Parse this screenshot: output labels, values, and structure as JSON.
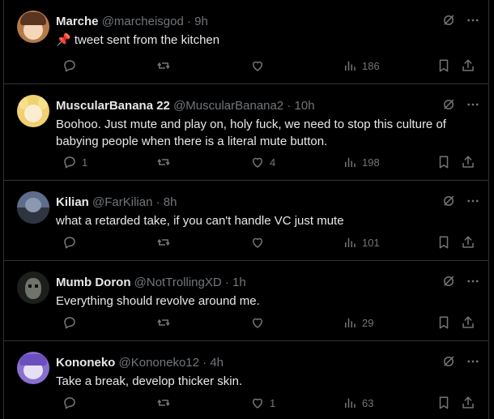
{
  "tweets": [
    {
      "name": "Marche",
      "handle": "@marcheisgod",
      "time": "9h",
      "text": "📌 tweet sent from the kitchen",
      "replies": "",
      "retweets": "",
      "likes": "",
      "views": "186",
      "avatar_color": "#b57a4a"
    },
    {
      "name": "MuscularBanana 22",
      "handle": "@MuscularBanana2",
      "time": "10h",
      "text": "Boohoo. Just mute and play on, holy fuck, we need to stop this culture of babying people when there is a literal mute button.",
      "replies": "1",
      "retweets": "",
      "likes": "4",
      "views": "198",
      "avatar_color": "#f0d070"
    },
    {
      "name": "Kilian",
      "handle": "@FarKilian",
      "time": "8h",
      "text": "what a retarded take, if you can't handle VC just mute",
      "replies": "",
      "retweets": "",
      "likes": "",
      "views": "101",
      "avatar_color": "#5d6d8a"
    },
    {
      "name": "Mumb Doron",
      "handle": "@NotTrollingXD",
      "time": "1h",
      "text": "Everything should revolve around me.",
      "replies": "",
      "retweets": "",
      "likes": "",
      "views": "29",
      "avatar_color": "#3a3f3a"
    },
    {
      "name": "Kononeko",
      "handle": "@Kononeko12",
      "time": "4h",
      "text": "Take a break, develop thicker skin.",
      "replies": "",
      "retweets": "",
      "likes": "1",
      "views": "63",
      "avatar_color": "#8a6fd0"
    }
  ],
  "separator": "·",
  "colors": {
    "background": "#000000",
    "border": "#2f3336",
    "muted": "#71767b",
    "text": "#e7e9ea"
  },
  "icons": [
    "grok-icon",
    "more-icon",
    "reply-icon",
    "retweet-icon",
    "like-icon",
    "views-icon",
    "bookmark-icon",
    "share-icon"
  ]
}
